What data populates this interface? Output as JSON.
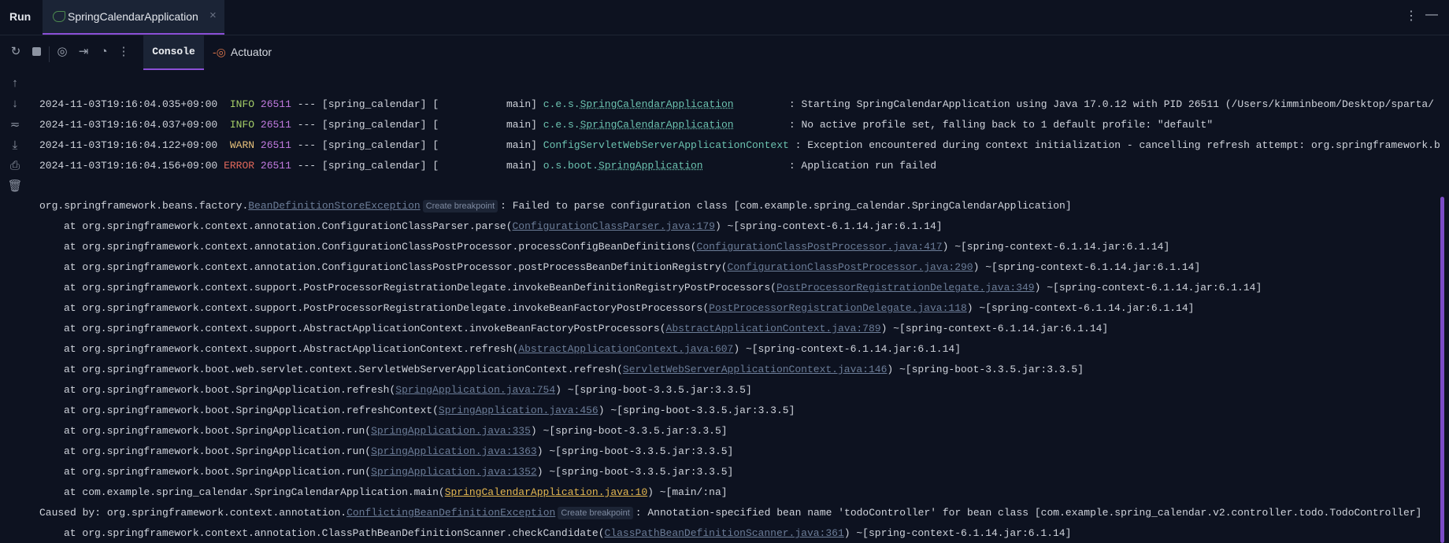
{
  "header": {
    "run_label": "Run",
    "run_tab": "SpringCalendarApplication",
    "close_glyph": "×",
    "more_glyph": "⋮",
    "minimize_glyph": "—"
  },
  "toolbar": {
    "tabs": [
      {
        "label": "Console"
      },
      {
        "label": "Actuator"
      }
    ],
    "more_glyph": "⋮"
  },
  "log_entries": [
    {
      "timestamp": "2024-11-03T19:16:04.035+09:00",
      "level": " INFO",
      "level_class": "INFO",
      "pid": "26511",
      "mid": " --- [spring_calendar] [           main] ",
      "logger_prefix": "c.e.s.",
      "logger_link": "SpringCalendarApplication",
      "logger_pad": "         ",
      "message": ": Starting SpringCalendarApplication using Java 17.0.12 with PID 26511 (/Users/kimminbeom/Desktop/sparta/"
    },
    {
      "timestamp": "2024-11-03T19:16:04.037+09:00",
      "level": " INFO",
      "level_class": "INFO",
      "pid": "26511",
      "mid": " --- [spring_calendar] [           main] ",
      "logger_prefix": "c.e.s.",
      "logger_link": "SpringCalendarApplication",
      "logger_pad": "         ",
      "message": ": No active profile set, falling back to 1 default profile: \"default\""
    },
    {
      "timestamp": "2024-11-03T19:16:04.122+09:00",
      "level": " WARN",
      "level_class": "WARN",
      "pid": "26511",
      "mid": " --- [spring_calendar] [           main] ",
      "logger_prefix": "ConfigServletWebServerApplicationContext",
      "logger_link": "",
      "logger_pad": " ",
      "message": ": Exception encountered during context initialization - cancelling refresh attempt: org.springframework.b"
    },
    {
      "timestamp": "2024-11-03T19:16:04.156+09:00",
      "level": "ERROR",
      "level_class": "ERROR",
      "pid": "26511",
      "mid": " --- [spring_calendar] [           main] ",
      "logger_prefix": "o.s.boot.",
      "logger_link": "SpringApplication",
      "logger_pad": "              ",
      "message": ": Application run failed"
    }
  ],
  "stack": [
    {
      "prefix": "org.springframework.beans.factory.",
      "link": "BeanDefinitionStoreException",
      "chip": "Create breakpoint",
      "suffix": ": Failed to parse configuration class [com.example.spring_calendar.SpringCalendarApplication]",
      "indent": false
    },
    {
      "prefix": "at org.springframework.context.annotation.ConfigurationClassParser.parse(",
      "link": "ConfigurationClassParser.java:179",
      "suffix": ") ~[spring-context-6.1.14.jar:6.1.14]",
      "indent": true
    },
    {
      "prefix": "at org.springframework.context.annotation.ConfigurationClassPostProcessor.processConfigBeanDefinitions(",
      "link": "ConfigurationClassPostProcessor.java:417",
      "suffix": ") ~[spring-context-6.1.14.jar:6.1.14]",
      "indent": true
    },
    {
      "prefix": "at org.springframework.context.annotation.ConfigurationClassPostProcessor.postProcessBeanDefinitionRegistry(",
      "link": "ConfigurationClassPostProcessor.java:290",
      "suffix": ") ~[spring-context-6.1.14.jar:6.1.14]",
      "indent": true
    },
    {
      "prefix": "at org.springframework.context.support.PostProcessorRegistrationDelegate.invokeBeanDefinitionRegistryPostProcessors(",
      "link": "PostProcessorRegistrationDelegate.java:349",
      "suffix": ") ~[spring-context-6.1.14.jar:6.1.14]",
      "indent": true
    },
    {
      "prefix": "at org.springframework.context.support.PostProcessorRegistrationDelegate.invokeBeanFactoryPostProcessors(",
      "link": "PostProcessorRegistrationDelegate.java:118",
      "suffix": ") ~[spring-context-6.1.14.jar:6.1.14]",
      "indent": true
    },
    {
      "prefix": "at org.springframework.context.support.AbstractApplicationContext.invokeBeanFactoryPostProcessors(",
      "link": "AbstractApplicationContext.java:789",
      "suffix": ") ~[spring-context-6.1.14.jar:6.1.14]",
      "indent": true
    },
    {
      "prefix": "at org.springframework.context.support.AbstractApplicationContext.refresh(",
      "link": "AbstractApplicationContext.java:607",
      "suffix": ") ~[spring-context-6.1.14.jar:6.1.14]",
      "indent": true
    },
    {
      "prefix": "at org.springframework.boot.web.servlet.context.ServletWebServerApplicationContext.refresh(",
      "link": "ServletWebServerApplicationContext.java:146",
      "suffix": ") ~[spring-boot-3.3.5.jar:3.3.5]",
      "indent": true
    },
    {
      "prefix": "at org.springframework.boot.SpringApplication.refresh(",
      "link": "SpringApplication.java:754",
      "suffix": ") ~[spring-boot-3.3.5.jar:3.3.5]",
      "indent": true
    },
    {
      "prefix": "at org.springframework.boot.SpringApplication.refreshContext(",
      "link": "SpringApplication.java:456",
      "suffix": ") ~[spring-boot-3.3.5.jar:3.3.5]",
      "indent": true
    },
    {
      "prefix": "at org.springframework.boot.SpringApplication.run(",
      "link": "SpringApplication.java:335",
      "suffix": ") ~[spring-boot-3.3.5.jar:3.3.5]",
      "indent": true
    },
    {
      "prefix": "at org.springframework.boot.SpringApplication.run(",
      "link": "SpringApplication.java:1363",
      "suffix": ") ~[spring-boot-3.3.5.jar:3.3.5]",
      "indent": true
    },
    {
      "prefix": "at org.springframework.boot.SpringApplication.run(",
      "link": "SpringApplication.java:1352",
      "suffix": ") ~[spring-boot-3.3.5.jar:3.3.5]",
      "indent": true
    },
    {
      "prefix": "at com.example.spring_calendar.SpringCalendarApplication.main(",
      "link": "SpringCalendarApplication.java:10",
      "own": true,
      "suffix": ") ~[main/:na]",
      "indent": true
    },
    {
      "prefix": "Caused by: org.springframework.context.annotation.",
      "link": "ConflictingBeanDefinitionException",
      "chip": "Create breakpoint",
      "suffix": ": Annotation-specified bean name 'todoController' for bean class [com.example.spring_calendar.v2.controller.todo.TodoController]",
      "indent": false
    },
    {
      "prefix": "at org.springframework.context.annotation.ClassPathBeanDefinitionScanner.checkCandidate(",
      "link": "ClassPathBeanDefinitionScanner.java:361",
      "suffix": ") ~[spring-context-6.1.14.jar:6.1.14]",
      "indent": true
    }
  ]
}
